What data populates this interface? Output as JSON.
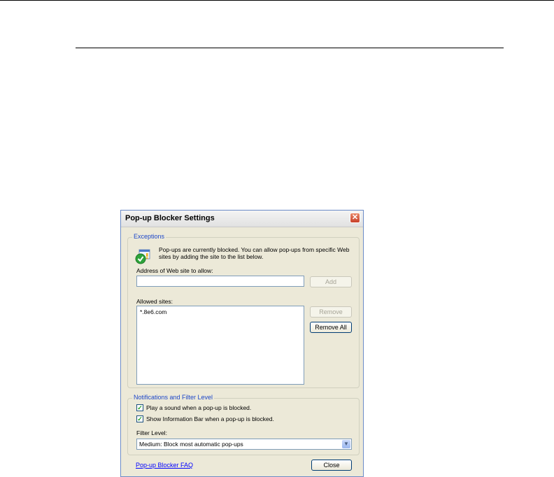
{
  "dialog": {
    "title": "Pop-up Blocker Settings",
    "close_glyph": "✕"
  },
  "exceptions": {
    "group_label": "Exceptions",
    "info_text": "Pop-ups are currently blocked.  You can allow pop-ups from specific Web sites by adding the site to the list below.",
    "address_label": "Address of Web site to allow:",
    "address_value": "",
    "add_label": "Add",
    "allowed_label": "Allowed sites:",
    "allowed_sites": [
      "*.8e6.com"
    ],
    "remove_label": "Remove",
    "remove_all_label": "Remove All"
  },
  "notifications": {
    "group_label": "Notifications and Filter Level",
    "play_sound_label": "Play a sound when a pop-up is blocked.",
    "play_sound_checked": true,
    "info_bar_label": "Show Information Bar when a pop-up is blocked.",
    "info_bar_checked": true,
    "filter_label": "Filter Level:",
    "filter_value": "Medium: Block most automatic pop-ups",
    "dropdown_glyph": "▼"
  },
  "footer": {
    "faq_link": "Pop-up Blocker FAQ",
    "close_label": "Close"
  },
  "icons": {
    "info_icon": "shield-check-icon",
    "check_glyph": "✓"
  }
}
